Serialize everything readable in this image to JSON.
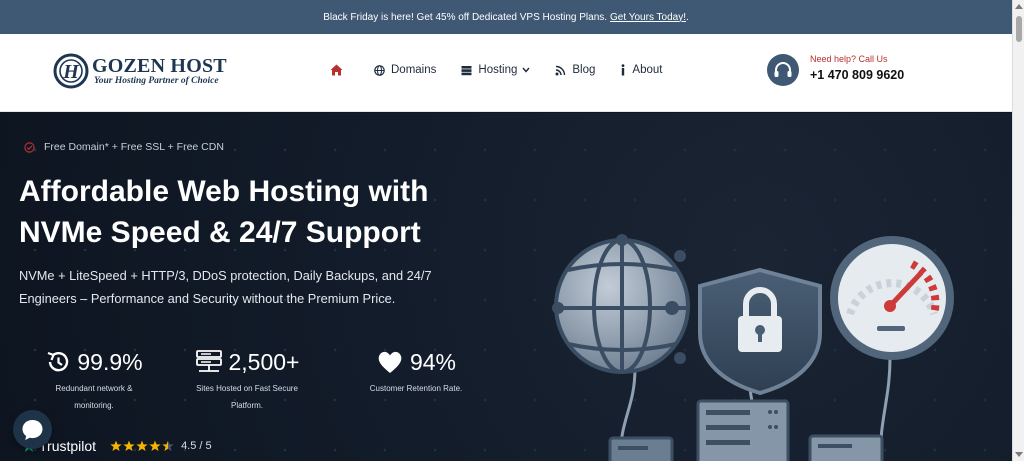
{
  "topbar": {
    "text": "Black Friday is here! Get 45% off Dedicated VPS Hosting Plans.",
    "link": "Get Yours Today!",
    "suffix": "."
  },
  "logo": {
    "brand": "GOZEN HOST",
    "tagline": "Your Hosting Partner of Choice",
    "mark_letter": "H",
    "icon": "gozen-logo-mark"
  },
  "nav": {
    "home_icon": "home-icon",
    "items": [
      {
        "label": "Domains",
        "icon": "globe-icon"
      },
      {
        "label": "Hosting",
        "icon": "server-icon",
        "has_dropdown": true
      },
      {
        "label": "Blog",
        "icon": "rss-icon"
      },
      {
        "label": "About",
        "icon": "info-icon"
      }
    ]
  },
  "help": {
    "label": "Need help? Call Us",
    "phone": "+1 470 809 9620",
    "icon": "headset-icon"
  },
  "hero": {
    "badge": "Free Domain* + Free SSL + Free CDN",
    "title_line1": "Affordable Web Hosting with",
    "title_line2": "NVMe Speed & 24/7 Support",
    "subtitle_line1": "NVMe + LiteSpeed + HTTP/3, DDoS protection, Daily Backups, and 24/7",
    "subtitle_line2": "Engineers – Performance and Security without the Premium Price."
  },
  "stats": [
    {
      "value": "99.9%",
      "desc_line1": "Redundant network &",
      "desc_line2": "monitoring.",
      "icon": "history-icon"
    },
    {
      "value": "2,500+",
      "desc_line1": "Sites Hosted on Fast Secure",
      "desc_line2": "Platform.",
      "icon": "server-rack-icon"
    },
    {
      "value": "94%",
      "desc_line1": "Customer Retention Rate.",
      "desc_line2": "",
      "icon": "heart-icon"
    }
  ],
  "trustpilot": {
    "name": "Trustpilot",
    "rating_text": "4.5 / 5",
    "rating": 4.5,
    "max": 5
  },
  "colors": {
    "topbar": "#3f5873",
    "brand_navy": "#1f3653",
    "accent_red": "#b8312f",
    "hero_bg": "#121b29",
    "star": "#f5b400"
  }
}
